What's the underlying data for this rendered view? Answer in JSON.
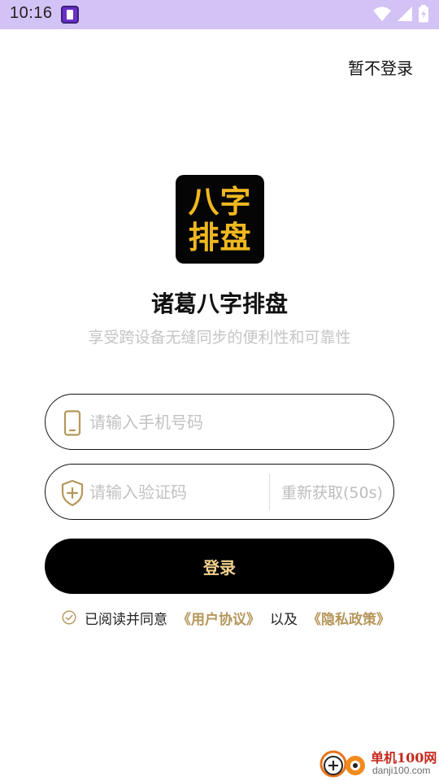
{
  "status_bar": {
    "time": "10:16",
    "icons": [
      "app-notification-icon",
      "wifi-icon",
      "cellular-signal-icon",
      "battery-charging-icon"
    ]
  },
  "header": {
    "skip_label": "暂不登录"
  },
  "app": {
    "logo_line1": "八字",
    "logo_line2": "排盘",
    "name": "诸葛八字排盘",
    "subtitle": "享受跨设备无缝同步的便利性和可靠性"
  },
  "form": {
    "phone": {
      "value": "",
      "placeholder": "请输入手机号码",
      "icon": "phone-icon"
    },
    "code": {
      "value": "",
      "placeholder": "请输入验证码",
      "icon": "shield-plus-icon"
    },
    "resend_label": "重新获取(50s)",
    "login_label": "登录"
  },
  "agreement": {
    "prefix": "已阅读并同意",
    "user_agreement": "《用户协议》",
    "conjunction": "以及",
    "privacy_policy": "《隐私政策》",
    "checked": false
  },
  "watermark": {
    "line1": "单机100网",
    "line2": "danji100.com"
  },
  "colors": {
    "status_bar": "#d3c2f5",
    "accent_gold": "#b5965a",
    "button_text": "#f2d28f",
    "logo_gold": "#f0b81f",
    "placeholder": "#c2c2c2"
  }
}
